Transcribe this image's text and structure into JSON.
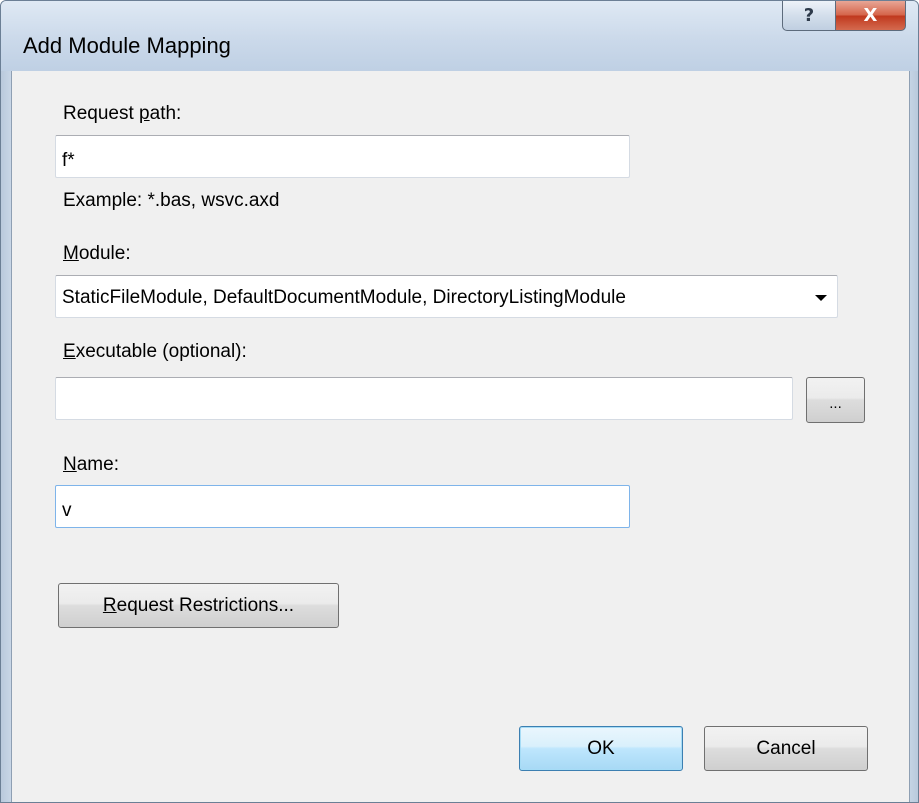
{
  "window": {
    "title": "Add Module Mapping",
    "help_glyph": "?",
    "close_glyph": "X"
  },
  "request_path": {
    "label_pre": "Request ",
    "label_accel": "p",
    "label_post": "ath:",
    "value": "f*",
    "example": "Example: *.bas, wsvc.axd"
  },
  "module": {
    "label_accel": "M",
    "label_post": "odule:",
    "selected": "StaticFileModule, DefaultDocumentModule, DirectoryListingModule"
  },
  "executable": {
    "label_accel": "E",
    "label_post": "xecutable (optional):",
    "value": "",
    "browse_label": "..."
  },
  "name": {
    "label_accel": "N",
    "label_post": "ame:",
    "value": "v"
  },
  "buttons": {
    "restrictions_accel": "R",
    "restrictions_post": "equest Restrictions...",
    "ok": "OK",
    "cancel": "Cancel"
  },
  "icons": {
    "help": "help-icon",
    "close": "close-icon",
    "dropdown": "chevron-down-icon"
  }
}
